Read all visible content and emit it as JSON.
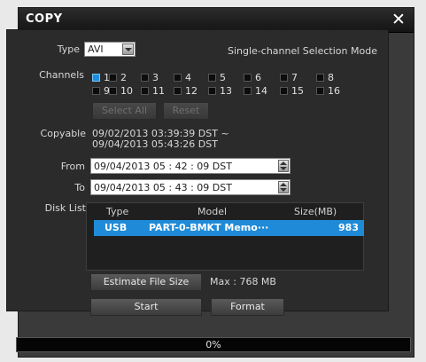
{
  "dialog": {
    "title": "COPY",
    "close_icon": "close-icon"
  },
  "type": {
    "label": "Type",
    "value": "AVI",
    "mode_text": "Single-channel Selection Mode"
  },
  "channels": {
    "label": "Channels",
    "items": [
      {
        "num": "1",
        "checked": true
      },
      {
        "num": "2",
        "checked": false
      },
      {
        "num": "3",
        "checked": false
      },
      {
        "num": "4",
        "checked": false
      },
      {
        "num": "5",
        "checked": false
      },
      {
        "num": "6",
        "checked": false
      },
      {
        "num": "7",
        "checked": false
      },
      {
        "num": "8",
        "checked": false
      },
      {
        "num": "9",
        "checked": false
      },
      {
        "num": "10",
        "checked": false
      },
      {
        "num": "11",
        "checked": false
      },
      {
        "num": "12",
        "checked": false
      },
      {
        "num": "13",
        "checked": false
      },
      {
        "num": "14",
        "checked": false
      },
      {
        "num": "15",
        "checked": false
      },
      {
        "num": "16",
        "checked": false
      }
    ],
    "select_all_label": "Select All",
    "reset_label": "Reset"
  },
  "copyable": {
    "label": "Copyable",
    "line1": "09/02/2013  03:39:39  DST ~",
    "line2": "09/04/2013  05:43:26  DST"
  },
  "from": {
    "label": "From",
    "value": "09/04/2013  05 : 42 : 09    DST"
  },
  "to": {
    "label": "To",
    "value": "09/04/2013  05 : 43 : 09    DST"
  },
  "disk_list": {
    "label": "Disk List",
    "columns": [
      "Type",
      "Model",
      "Size(MB)"
    ],
    "rows": [
      {
        "type": "USB",
        "model": "PART-0-BMKT Memo···",
        "size": "983"
      }
    ]
  },
  "estimate": {
    "button_label": "Estimate File Size",
    "max_text": "Max : 768 MB"
  },
  "actions": {
    "start_label": "Start",
    "format_label": "Format"
  },
  "progress": {
    "percent_text": "0%",
    "value": 0
  },
  "colors": {
    "accent": "#1f8bd8",
    "panel": "#2b2b2b",
    "dialog": "#3a3a3a"
  }
}
